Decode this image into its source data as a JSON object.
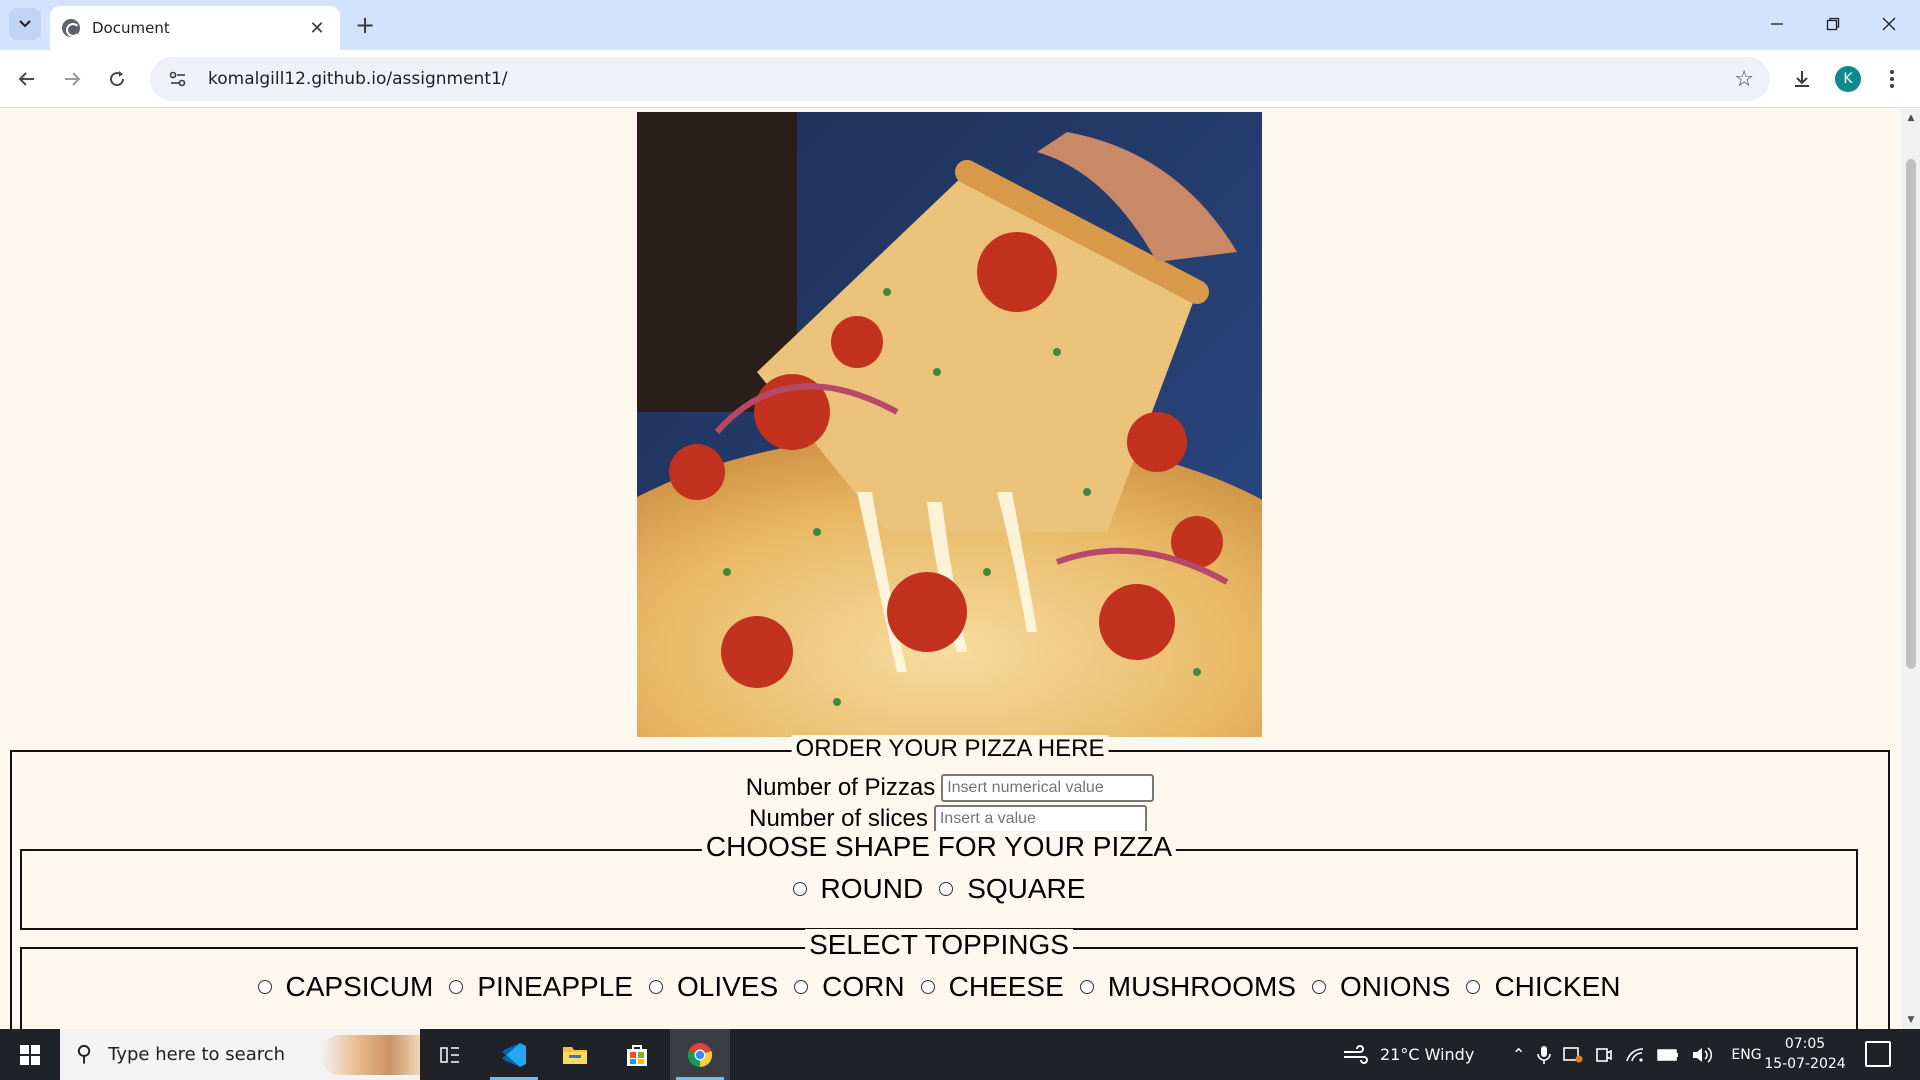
{
  "browser": {
    "tab_title": "Document",
    "url": "komalgill12.github.io/assignment1/",
    "profile_initial": "K"
  },
  "page": {
    "hero_image_alt": "pizza-slice-photo",
    "form": {
      "legend": "ORDER YOUR PIZZA HERE",
      "pizzas_label": "Number of Pizzas",
      "pizzas_placeholder": "Insert numerical value",
      "slices_label": "Number of slices",
      "slices_placeholder": "Insert a value",
      "shape_legend": "CHOOSE SHAPE FOR YOUR PIZZA",
      "shapes": [
        "ROUND",
        "SQUARE"
      ],
      "toppings_legend": "SELECT TOPPINGS",
      "toppings": [
        "CAPSICUM",
        "PINEAPPLE",
        "OLIVES",
        "CORN",
        "CHEESE",
        "MUSHROOMS",
        "ONIONS",
        "CHICKEN"
      ]
    }
  },
  "taskbar": {
    "search_placeholder": "Type here to search",
    "weather": "21°C  Windy",
    "language": "ENG",
    "time": "07:05",
    "date": "15-07-2024"
  },
  "colors": {
    "page_bg": "#fdf8ee",
    "tabstrip_bg": "#d3e3fd",
    "taskbar_bg": "#1f2227",
    "avatar_bg": "#0e8a8c"
  }
}
